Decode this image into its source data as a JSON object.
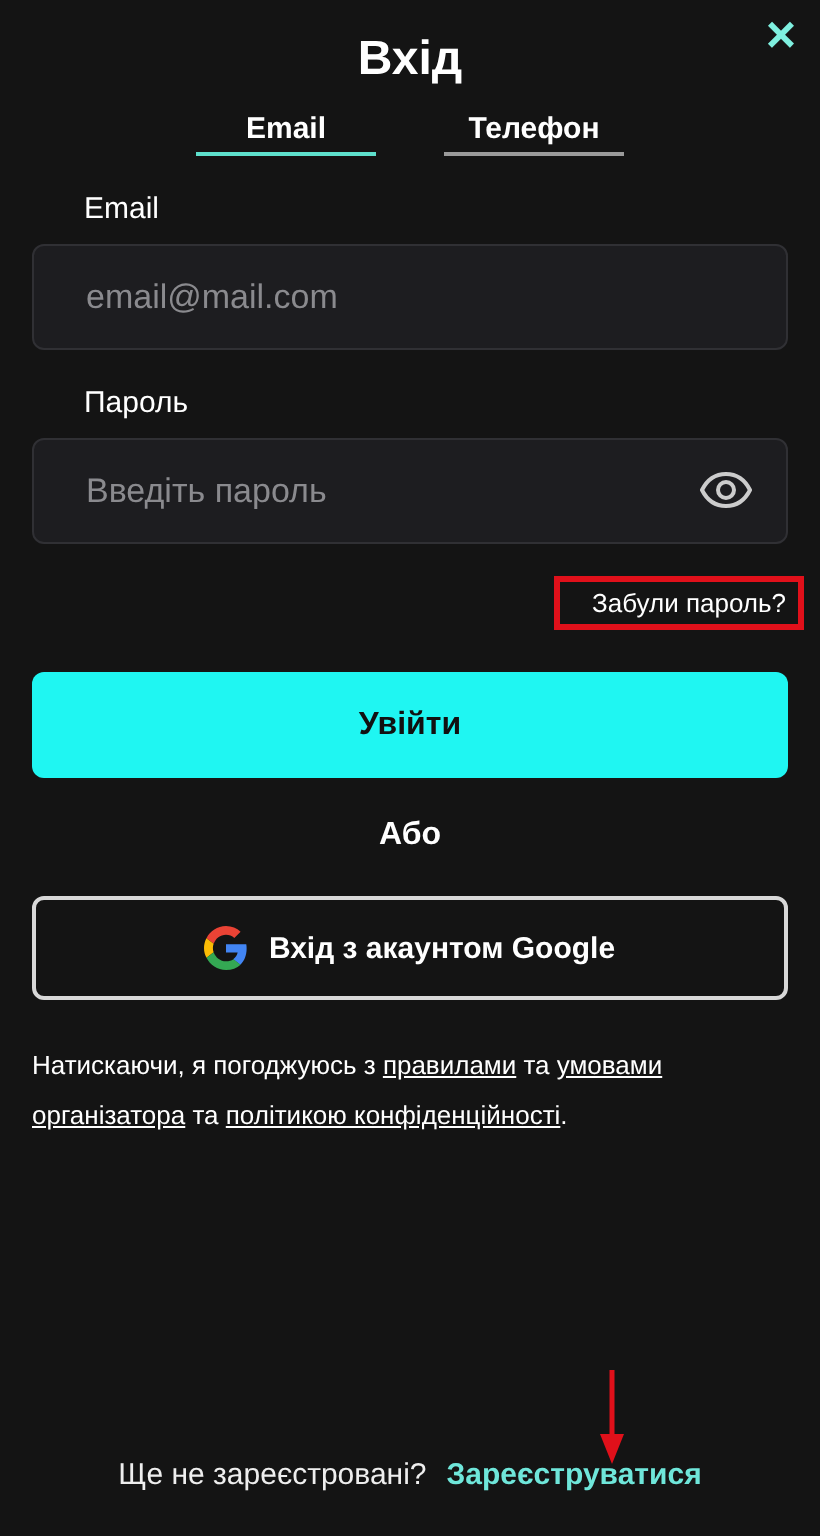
{
  "dialog": {
    "title": "Вхід",
    "close": "×"
  },
  "tabs": [
    {
      "label": "Email",
      "selected": true
    },
    {
      "label": "Телефон",
      "selected": false
    }
  ],
  "fields": [
    {
      "label": "Email",
      "placeholder": "email@mail.com",
      "kind": "text"
    },
    {
      "label": "Пароль",
      "placeholder": "Введіть пароль",
      "kind": "password"
    }
  ],
  "forgot_password": {
    "label": "Забули пароль?",
    "highlighted": true
  },
  "submit_button": "Увійти",
  "divider_text": "Або",
  "google_button": "Вхід з акаунтом Google",
  "consent": [
    {
      "kind": "text",
      "text": "Натискаючи, я погоджуюсь з "
    },
    {
      "kind": "link",
      "text": "правилами"
    },
    {
      "kind": "text",
      "text": " та "
    },
    {
      "kind": "link",
      "text": "умовами"
    },
    {
      "kind": "line_break"
    },
    {
      "kind": "link",
      "text": "організатора"
    },
    {
      "kind": "text",
      "text": " та "
    },
    {
      "kind": "link",
      "text": "політикою конфіденційності"
    },
    {
      "kind": "text",
      "text": "."
    }
  ],
  "footer": {
    "question": "Ще не зареєстровані?",
    "link": "Зареєструватися",
    "arrow_annotation": true
  }
}
